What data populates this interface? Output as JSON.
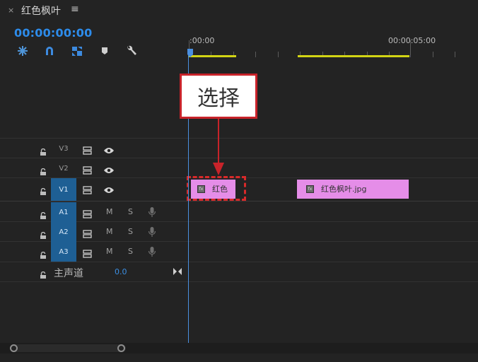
{
  "panel": {
    "close_symbol": "×",
    "title": "红色枫叶",
    "menu_symbol": "≡",
    "timecode": "00:00:00:00"
  },
  "toolbar": {
    "icons": [
      "insert-sequence-icon",
      "snap-magnet-icon",
      "linked-selection-icon",
      "add-marker-icon",
      "wrench-settings-icon"
    ]
  },
  "ruler": {
    "start_label": ":00:00",
    "mark_label": "00:00:05:00"
  },
  "tracks": {
    "video": [
      {
        "label": "V3",
        "targeted": false
      },
      {
        "label": "V2",
        "targeted": false
      },
      {
        "label": "V1",
        "targeted": true
      }
    ],
    "audio": [
      {
        "label": "A1",
        "mute": "M",
        "solo": "S"
      },
      {
        "label": "A2",
        "mute": "M",
        "solo": "S"
      },
      {
        "label": "A3",
        "mute": "M",
        "solo": "S"
      }
    ],
    "master": {
      "label": "主声道",
      "value": "0.0"
    }
  },
  "clips": [
    {
      "name": "红色",
      "fx": "fx"
    },
    {
      "name": "红色枫叶.jpg",
      "fx": "fx"
    }
  ],
  "annotation": {
    "callout_text": "选择",
    "color": "#c8232a"
  },
  "colors": {
    "accent": "#2d8ceb",
    "clip": "#e58de8",
    "work_area": "#d2d414",
    "target_active": "#1e5f94"
  }
}
